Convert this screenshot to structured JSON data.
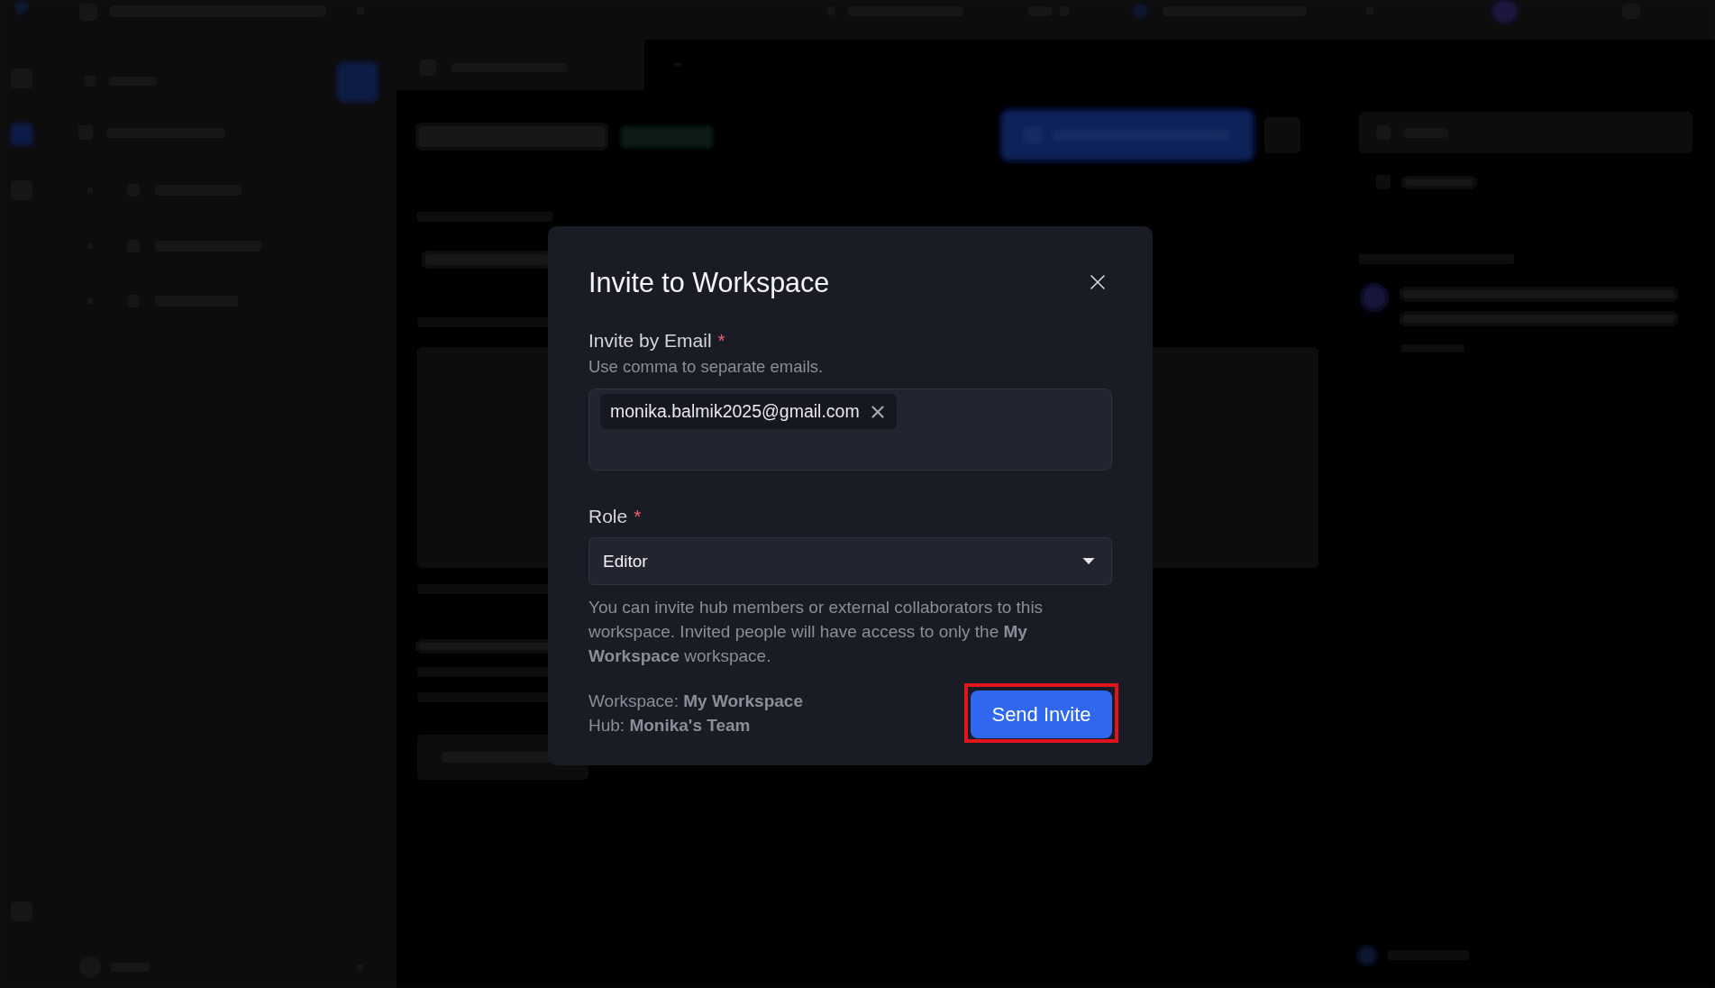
{
  "dialog": {
    "title": "Invite to Workspace",
    "email_field": {
      "label": "Invite by Email",
      "required_mark": "*",
      "hint": "Use comma to separate emails.",
      "chips": [
        {
          "text": "monika.balmik2025@gmail.com"
        }
      ]
    },
    "role_field": {
      "label": "Role",
      "required_mark": "*",
      "value": "Editor"
    },
    "note": "You can invite hub members or external collaborators to this workspace. Invited people will have access to only the **My Workspace** workspace.",
    "details": [
      "Workspace: **My Workspace**",
      "Hub: **Monika's Team**"
    ],
    "submit_button": {
      "label": "Send Invite",
      "highlighted": true
    }
  }
}
